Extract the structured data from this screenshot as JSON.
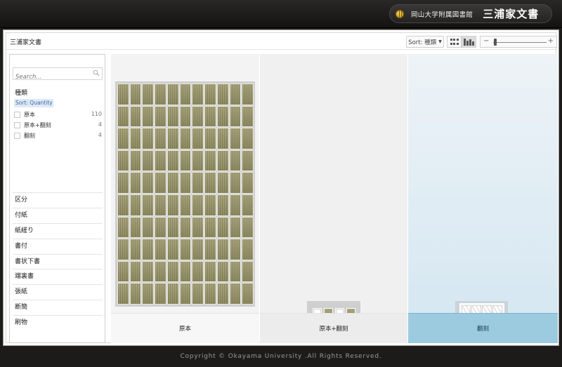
{
  "header": {
    "university": "岡山大学附属図書館",
    "collection": "三浦家文書"
  },
  "toolbar": {
    "title": "三浦家文書",
    "sort_label": "Sort: 種類",
    "zoom_minus": "−",
    "zoom_plus": "+",
    "zoom_level": 0.02
  },
  "sidebar": {
    "search_placeholder": "Search...",
    "facet_title": "種類",
    "sort_mode": "Sort: Quantity",
    "facet_items": [
      {
        "label": "原本",
        "count": "110"
      },
      {
        "label": "原本+翻刻",
        "count": "4"
      },
      {
        "label": "翻刻",
        "count": "4"
      }
    ],
    "categories": [
      "区分",
      "付紙",
      "紙縒り",
      "書付",
      "書状下書",
      "端裏書",
      "張紙",
      "断簡",
      "刷物"
    ]
  },
  "columns": [
    {
      "label": "原本",
      "count": 110
    },
    {
      "label": "原本+翻刻",
      "count": 4
    },
    {
      "label": "翻刻",
      "count": 4
    }
  ],
  "footer": {
    "copyright": "Copyright © Okayama University .All Rights Reserved."
  },
  "colors": {
    "selected_column": "#9ccbe0",
    "sort_highlight": "#dde9f6",
    "tile": "#9c9770"
  }
}
